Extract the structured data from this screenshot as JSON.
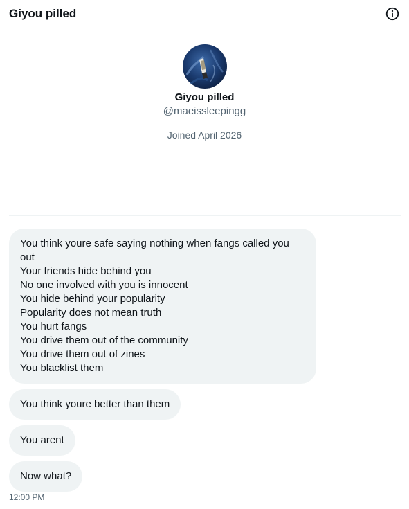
{
  "header": {
    "title": "Giyou pilled",
    "info_icon": "info-circle-icon"
  },
  "profile": {
    "name": "Giyou pilled",
    "handle": "@maeissleepingg",
    "joined": "Joined April 2026"
  },
  "messages": [
    {
      "lines": [
        "You think youre safe saying nothing when fangs called you",
        "out",
        "Your friends hide behind you",
        "No one involved with you is innocent",
        "You hide behind your popularity",
        "Popularity does not mean truth",
        "You hurt fangs",
        "You drive them out of the community",
        "You drive them out of zines",
        "You blacklist them"
      ]
    },
    {
      "text": "You think youre better than them"
    },
    {
      "text": "You arent"
    },
    {
      "text": "Now what?"
    }
  ],
  "timestamp": "12:00 PM",
  "colors": {
    "bubble_bg": "#eff3f4",
    "text_primary": "#0f1419",
    "text_secondary": "#536471"
  }
}
